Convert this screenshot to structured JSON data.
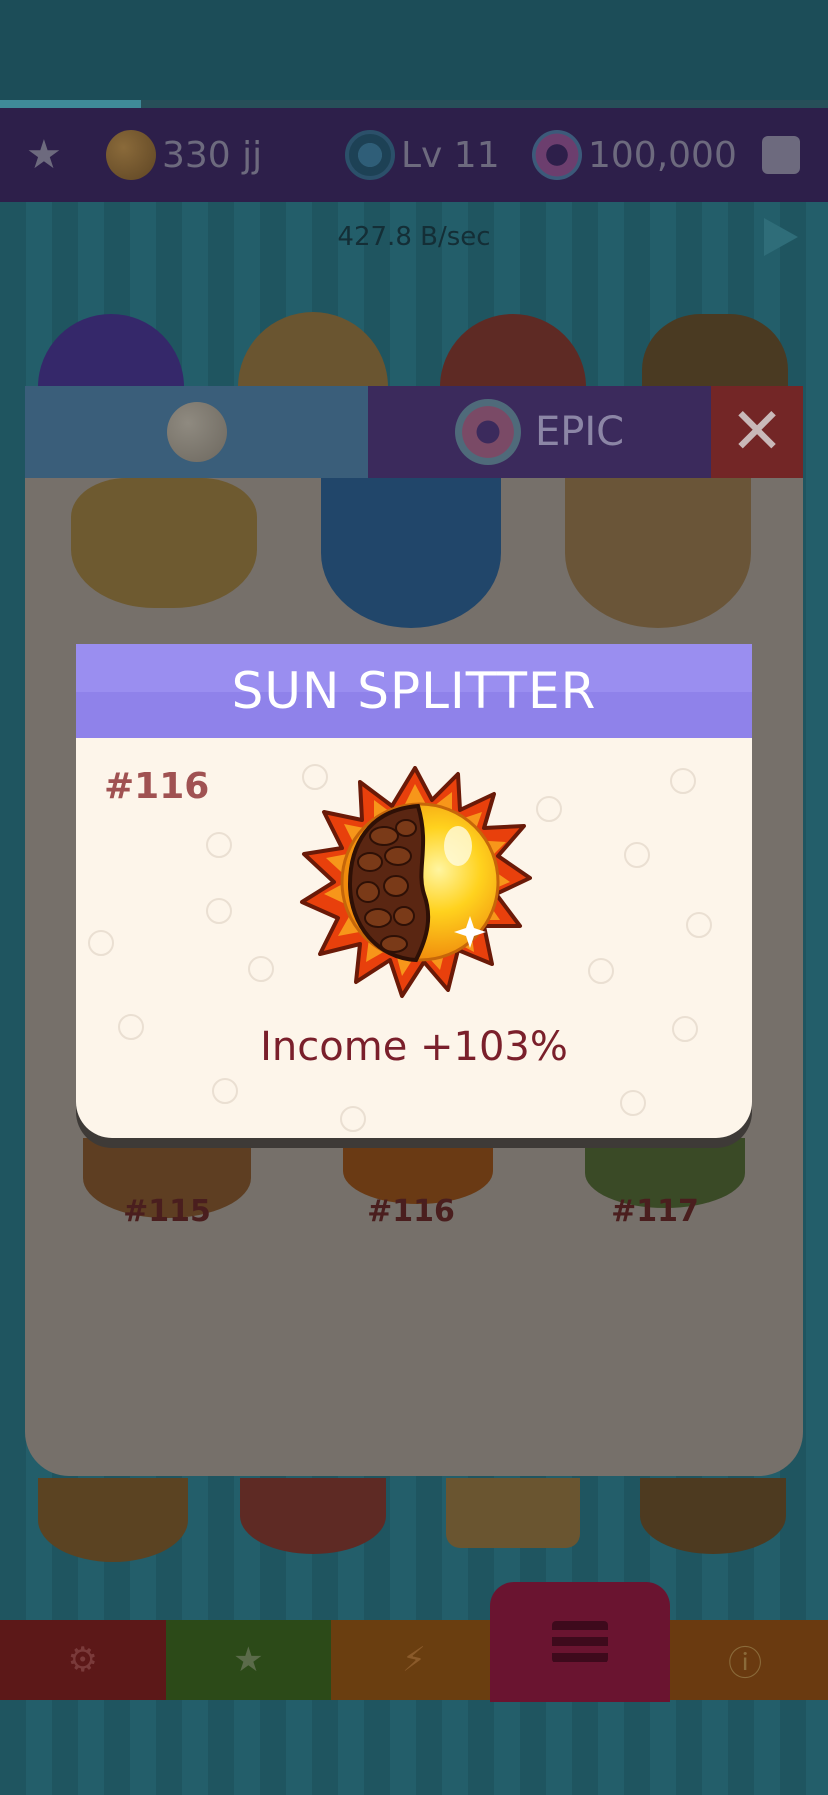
{
  "hud": {
    "cookies": "330 jj",
    "level": "Lv 11",
    "donuts": "100,000",
    "rate": "427.8 B/sec",
    "progress_fraction": 0.17
  },
  "panel": {
    "tab_epic_label": "EPIC",
    "close_symbol": "✕",
    "grid_labels": [
      "#115",
      "#116",
      "#117"
    ]
  },
  "popup": {
    "title": "SUN SPLITTER",
    "number": "#116",
    "income": "Income +103%"
  },
  "icons": {
    "star": "star-icon",
    "calendar": "calendar-icon",
    "play": "play-icon",
    "gear": "gear-icon",
    "lightning": "lightning-icon",
    "info": "info-icon",
    "menu": "menu-icon"
  },
  "colors": {
    "popup_header": "#8f82ea",
    "popup_body": "#fdf5ea",
    "title_text": "#ffffff",
    "income_text": "#7a1f2b",
    "close_button": "#732626"
  }
}
